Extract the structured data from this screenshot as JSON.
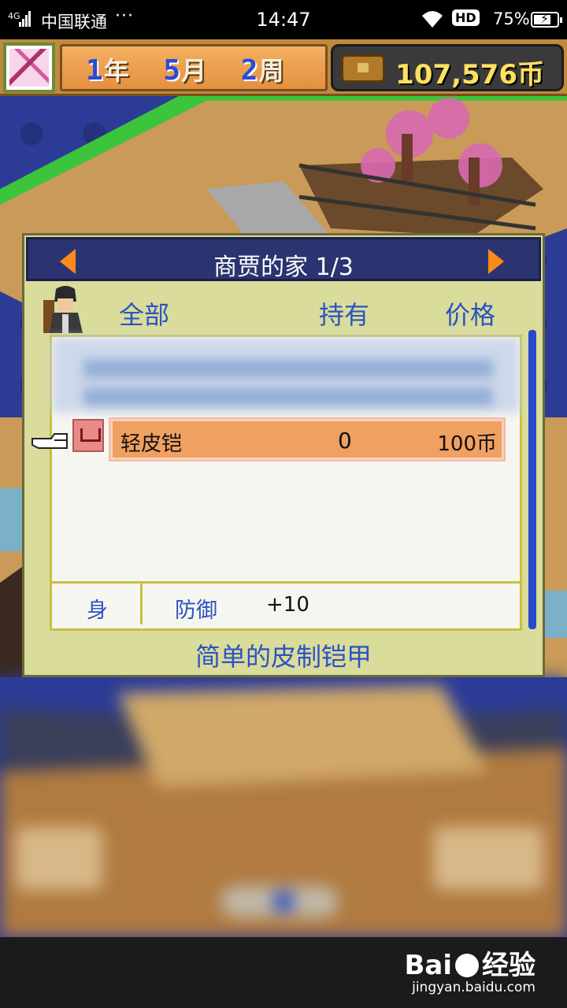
{
  "status_bar": {
    "network": "4G",
    "carrier": "中国联通",
    "more": "···",
    "time": "14:47",
    "hd": "HD",
    "battery_pct": "75%",
    "battery_level": 0.75
  },
  "hud": {
    "year_num": "1",
    "year_unit": "年",
    "month_num": "5",
    "month_unit": "月",
    "week_num": "2",
    "week_unit": "周",
    "money": "107,576币"
  },
  "shop": {
    "title": "商贾的家 1/3",
    "columns": {
      "category": "全部",
      "held": "持有",
      "price": "价格"
    },
    "selected_item": {
      "name": "轻皮铠",
      "held": "0",
      "price": "100币"
    },
    "stats": {
      "slot": "身",
      "label": "防御",
      "value": "+10"
    },
    "description": "简单的皮制铠甲"
  },
  "watermark": {
    "brand": "Bai经验",
    "url": "jingyan.baidu.com"
  },
  "colors": {
    "accent_blue": "#2c52c4",
    "highlight": "#f0a060",
    "title_bar": "#2b3470"
  }
}
